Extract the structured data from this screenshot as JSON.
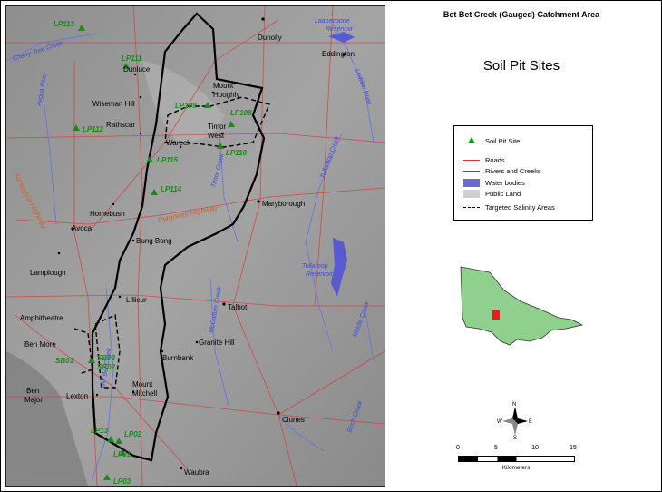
{
  "header": {
    "catchment_title": "Bet Bet Creek (Gauged) Catchment Area",
    "map_title": "Soil Pit Sites"
  },
  "legend": {
    "items": [
      {
        "label": "Soil Pit Site",
        "symbol": "triangle",
        "color": "#1a8a1a"
      },
      {
        "label": "Roads",
        "symbol": "line",
        "color": "#e03030"
      },
      {
        "label": "Rivers and Creeks",
        "symbol": "line",
        "color": "#3a4ee0"
      },
      {
        "label": "Water bodies",
        "symbol": "fill",
        "color": "#6b6bd8"
      },
      {
        "label": "Public Land",
        "symbol": "fill",
        "color": "#cfcfcf"
      },
      {
        "label": "Targeted Salinity Areas",
        "symbol": "dashed-line",
        "color": "#000000"
      }
    ]
  },
  "north_arrow": {
    "n": "N",
    "s": "S",
    "e": "E",
    "w": "W"
  },
  "scale_bar": {
    "ticks": [
      "0",
      "5",
      "10",
      "15"
    ],
    "unit": "Kilometers"
  },
  "map": {
    "towns": [
      "Dunolly",
      "Eddington",
      "Dunluce",
      "Mount",
      "Hooghly",
      "Wiseman Hill",
      "Rathscar",
      "Timor",
      "West",
      "Wareek",
      "Homebush",
      "Maryborough",
      "Avoca",
      "Bung Bong",
      "Lamplough",
      "Lillicur",
      "Talbot",
      "Amphitheatre",
      "Ben More",
      "Burnbank",
      "Granite Hill",
      "Ben",
      "Major",
      "Lexton",
      "Mount",
      "Mitchell",
      "Clunes",
      "Waubra"
    ],
    "soil_pits": [
      "LP113",
      "LP111",
      "LP112",
      "LP109",
      "LP108",
      "LP110",
      "LP115",
      "LP114",
      "SB01",
      "SB03",
      "SB02",
      "LP13",
      "LP02",
      "LP01",
      "LP03"
    ],
    "waterways": [
      "Cherry Tree Creek",
      "Laanecoorie",
      "Reservoir",
      "Loddon River",
      "Avoca River",
      "Tullaroop Creek",
      "Timor Creek",
      "Bet Bet Creek",
      "McCallum Creek",
      "Tullaroop",
      "Reservoir",
      "Middle Creek",
      "Birch Creek"
    ],
    "highways": [
      "Sunraysia Highway",
      "Pyrenees Highway"
    ]
  }
}
